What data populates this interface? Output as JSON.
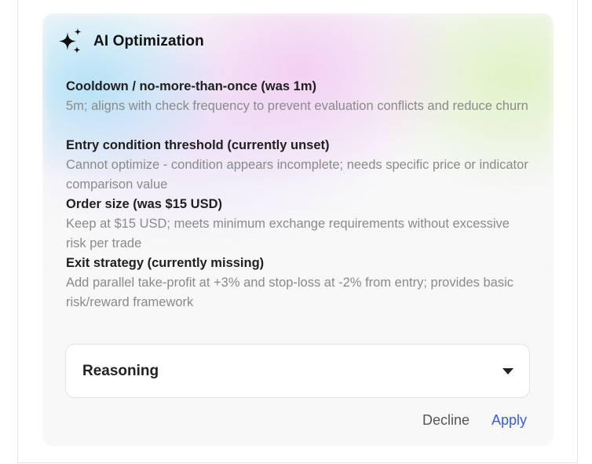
{
  "panel": {
    "title": "AI Optimization",
    "icon": "sparkles-icon",
    "accent_color": "#3b5bdb"
  },
  "items": [
    {
      "label": "Cooldown / no-more-than-once (was 1m)",
      "detail": "5m; aligns with check frequency to prevent evaluation conflicts and reduce churn"
    },
    {
      "label": "Entry condition threshold (currently unset)",
      "detail": "Cannot optimize - condition appears incomplete; needs specific price or indicator comparison value"
    },
    {
      "label": "Order size (was $15 USD)",
      "detail": "Keep at $15 USD; meets minimum exchange requirements without excessive risk per trade"
    },
    {
      "label": "Exit strategy (currently missing)",
      "detail": "Add parallel take-profit at +3% and stop-loss at -2% from entry; provides basic risk/reward framework"
    }
  ],
  "reasoning": {
    "label": "Reasoning",
    "icon": "chevron-down-icon"
  },
  "actions": {
    "decline_label": "Decline",
    "apply_label": "Apply"
  }
}
